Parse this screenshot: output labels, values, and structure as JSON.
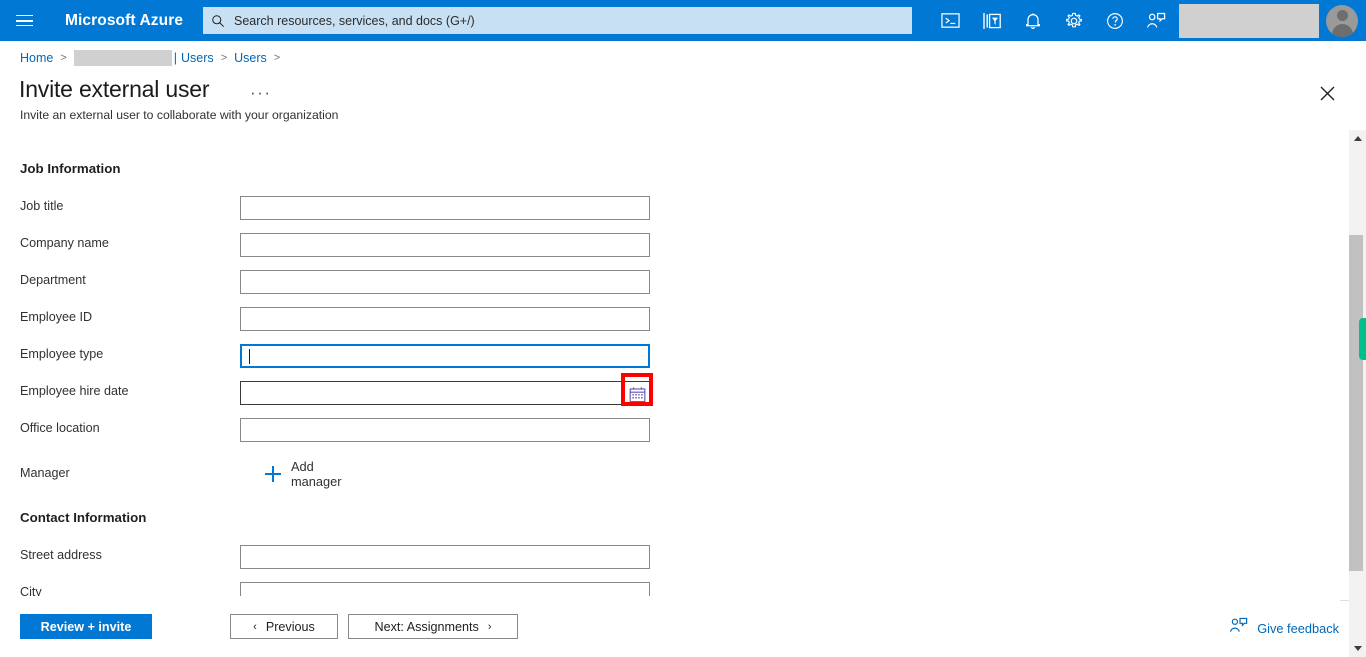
{
  "topbar": {
    "menu_icon": "hamburger-icon",
    "brand": "Microsoft Azure",
    "search_placeholder": "Search resources, services, and docs (G+/)",
    "search_value": "",
    "icons": [
      {
        "name": "cloud-shell-icon",
        "title": "Cloud Shell"
      },
      {
        "name": "directory-filter-icon",
        "title": "Directories + subscriptions"
      },
      {
        "name": "notifications-bell-icon",
        "title": "Notifications"
      },
      {
        "name": "settings-gear-icon",
        "title": "Settings"
      },
      {
        "name": "help-question-icon",
        "title": "Help"
      },
      {
        "name": "feedback-person-icon",
        "title": "Feedback"
      }
    ],
    "account_redacted": "",
    "avatar": "user-avatar"
  },
  "breadcrumb": {
    "home": "Home",
    "separator": ">",
    "redacted_tenant": "",
    "pipe": "|",
    "items": [
      "Users",
      "Users"
    ],
    "trailing": ">"
  },
  "page": {
    "title": "Invite external user",
    "more_menu": "···",
    "subtitle": "Invite an external user to collaborate with your organization",
    "close": "✕"
  },
  "sections": [
    {
      "heading": "Job Information",
      "rows": [
        {
          "label": "Job title",
          "value": "",
          "type": "text",
          "focused": false
        },
        {
          "label": "Company name",
          "value": "",
          "type": "text",
          "focused": false
        },
        {
          "label": "Department",
          "value": "",
          "type": "text",
          "focused": false
        },
        {
          "label": "Employee ID",
          "value": "",
          "type": "text",
          "focused": false
        },
        {
          "label": "Employee type",
          "value": "",
          "type": "text",
          "focused": true
        },
        {
          "label": "Employee hire date",
          "value": "",
          "type": "date",
          "focused": false,
          "icon": "calendar-icon",
          "highlighted": true
        },
        {
          "label": "Office location",
          "value": "",
          "type": "text",
          "focused": false
        },
        {
          "label": "Manager",
          "type": "link",
          "link_label": "Add manager",
          "link_icon": "plus-icon"
        }
      ]
    },
    {
      "heading": "Contact Information",
      "rows": [
        {
          "label": "Street address",
          "value": "",
          "type": "text",
          "focused": false
        },
        {
          "label": "City",
          "value": "",
          "type": "text",
          "focused": false
        }
      ]
    }
  ],
  "footer": {
    "primary": "Review + invite",
    "previous": "Previous",
    "previous_chevron": "‹",
    "next": "Next: Assignments",
    "next_chevron": "›",
    "feedback": "Give feedback",
    "feedback_icon": "feedback-person-icon"
  },
  "scrollbar": {
    "up_arrow": "scroll-up-arrow",
    "down_arrow": "scroll-down-arrow",
    "thumb": "scroll-thumb",
    "marker_color": "#00C08B"
  },
  "colors": {
    "brand_blue": "#0078D4",
    "link_blue": "#0067B8",
    "search_bg": "#C7E0F4",
    "annotation_red": "#FF0000",
    "redaction_gray": "#D0D0D0"
  }
}
